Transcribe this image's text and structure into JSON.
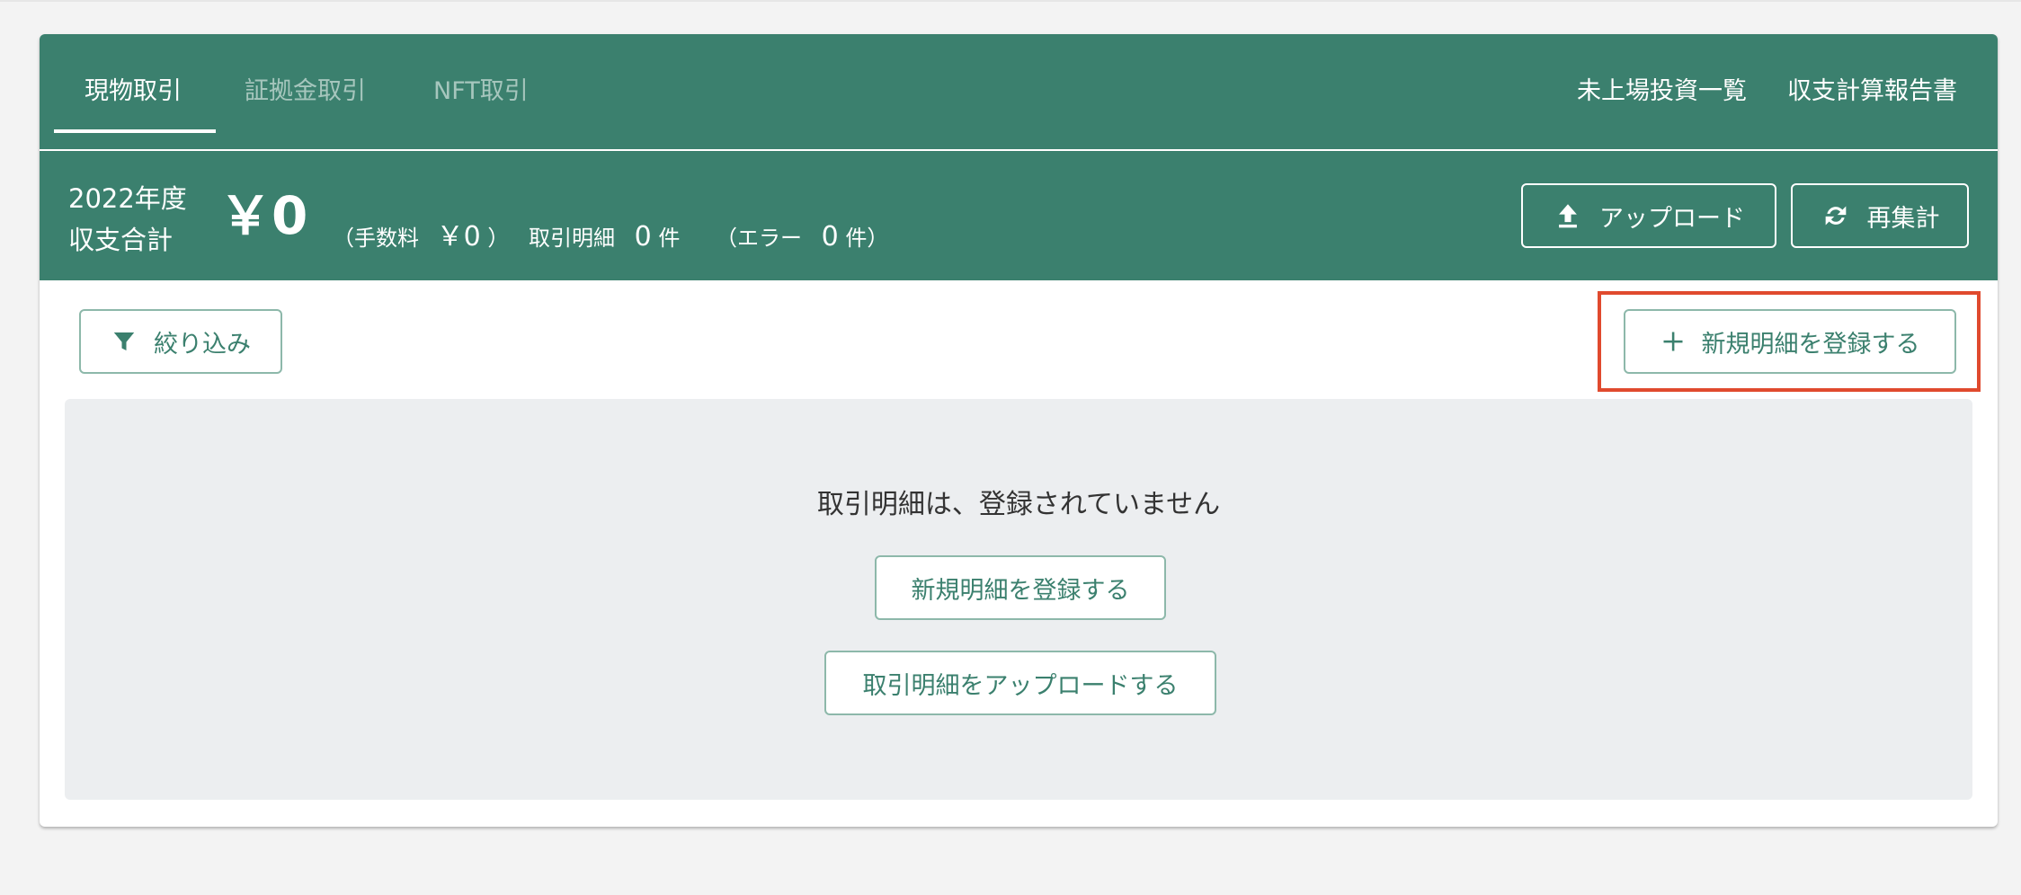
{
  "tabs": [
    {
      "label": "現物取引",
      "active": true
    },
    {
      "label": "証拠金取引",
      "active": false
    },
    {
      "label": "NFT取引",
      "active": false
    }
  ],
  "top_links": {
    "unlisted": "未上場投資一覧",
    "report": "収支計算報告書"
  },
  "summary": {
    "year_label": "2022年度",
    "total_label": "収支合計",
    "total_value": "￥0",
    "fee_open": "（手数料",
    "fee_value": "￥0",
    "fee_close": "）",
    "details_label": "取引明細",
    "details_count": "0",
    "details_unit": "件",
    "error_open": "（エラー",
    "error_count": "0",
    "error_unit": "件）"
  },
  "buttons": {
    "upload": "アップロード",
    "recalc": "再集計",
    "filter": "絞り込み",
    "new_detail": "新規明細を登録する"
  },
  "empty_state": {
    "message": "取引明細は、登録されていません",
    "register_button": "新規明細を登録する",
    "upload_button": "取引明細をアップロードする"
  },
  "colors": {
    "brand_green": "#3b806e",
    "highlight_red": "#e04a2e",
    "panel_gray": "#eceef0"
  },
  "icons": [
    "upload-icon",
    "refresh-icon",
    "filter-icon",
    "plus-icon"
  ]
}
